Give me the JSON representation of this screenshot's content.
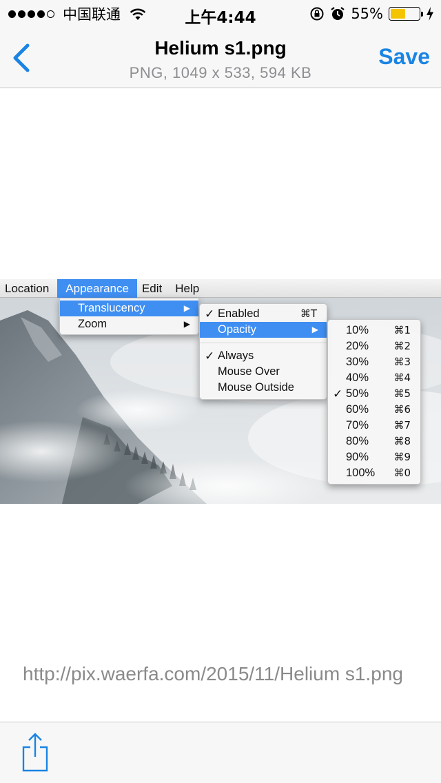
{
  "status_bar": {
    "carrier": "中国联通",
    "time": "上午4:44",
    "battery_percent": "55%",
    "battery_level": 0.55,
    "battery_color": "#f5c400",
    "icons": [
      "signal-dots",
      "wifi-icon",
      "orientation-lock-icon",
      "alarm-icon",
      "battery-icon",
      "charging-bolt-icon"
    ]
  },
  "nav": {
    "back_icon": "chevron-left-icon",
    "title": "Helium s1.png",
    "subtitle": "PNG, 1049 x 533, 594 KB",
    "save_label": "Save",
    "accent_color": "#1a84e4"
  },
  "preview": {
    "menubar": [
      "Location",
      "Appearance",
      "Edit",
      "Help"
    ],
    "appearance_menu": [
      {
        "label": "Translucency",
        "submenu": true
      },
      {
        "label": "Zoom",
        "submenu": true
      }
    ],
    "translucency_menu": {
      "enabled": {
        "label": "Enabled",
        "checked": true,
        "shortcut": "⌘T"
      },
      "opacity": {
        "label": "Opacity",
        "submenu": true
      },
      "modes": [
        {
          "label": "Always",
          "checked": true
        },
        {
          "label": "Mouse Over",
          "checked": false
        },
        {
          "label": "Mouse Outside",
          "checked": false
        }
      ]
    },
    "opacity_menu": [
      {
        "label": "10%",
        "shortcut": "⌘1",
        "checked": false
      },
      {
        "label": "20%",
        "shortcut": "⌘2",
        "checked": false
      },
      {
        "label": "30%",
        "shortcut": "⌘3",
        "checked": false
      },
      {
        "label": "40%",
        "shortcut": "⌘4",
        "checked": false
      },
      {
        "label": "50%",
        "shortcut": "⌘5",
        "checked": true
      },
      {
        "label": "60%",
        "shortcut": "⌘6",
        "checked": false
      },
      {
        "label": "70%",
        "shortcut": "⌘7",
        "checked": false
      },
      {
        "label": "80%",
        "shortcut": "⌘8",
        "checked": false
      },
      {
        "label": "90%",
        "shortcut": "⌘9",
        "checked": false
      },
      {
        "label": "100%",
        "shortcut": "⌘0",
        "checked": false
      }
    ],
    "highlight_color": "#3f8ef2"
  },
  "url": "http://pix.waerfa.com/2015/11/Helium s1.png",
  "toolbar": {
    "share_icon": "share-icon"
  }
}
